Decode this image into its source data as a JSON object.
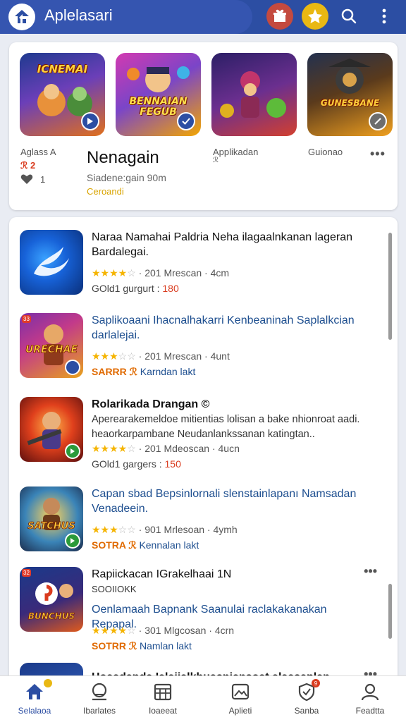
{
  "header": {
    "title": "Aplelasari",
    "icons": [
      "app-logo-icon",
      "gift-icon",
      "star-icon",
      "search-icon",
      "more-vert-icon"
    ]
  },
  "featured": {
    "tiles": [
      {
        "art_text": "ICNEMAI",
        "colors": [
          "#2a3f9a",
          "#e56a1c"
        ]
      },
      {
        "art_text": "BENNAIAN FEGUB",
        "colors": [
          "#c03ab8",
          "#f3c200"
        ]
      },
      {
        "art_text": "",
        "colors": [
          "#3b2b7a",
          "#d23a2f"
        ]
      },
      {
        "art_text": "GUNESBANE",
        "colors": [
          "#3b2a18",
          "#e89b22"
        ]
      }
    ],
    "caption_left": "Aglass A",
    "caption_left_code": "ℛ 2",
    "caption_left_count": "1",
    "title": "Nenagain",
    "subtitle": "Siadene:gain 90m",
    "tagline": "Ceroandi",
    "caption_3": "Applikadan",
    "caption_3_sub": "ℛ",
    "caption_4": "Guionao",
    "more": "•••"
  },
  "apps": [
    {
      "title": "Naraa Namahai Paldria Neha ilagaalnkanan lageran Bardalegai.",
      "title_style": "dark",
      "rating": 4,
      "meta": "· 201 Mrescan · 4cm",
      "extra_label": "GOld1 gurgurt : ",
      "extra_value": "180",
      "extra_style": "price"
    },
    {
      "title": "Saplikoaani Ihacnalhakarri Kenbeaninah Saplalkcian darlalejai.",
      "title_style": "blue",
      "rating": 3,
      "meta": "· 201 Mrescan · 4unt",
      "extra_label": "SARRR ℛ ",
      "extra_value": "Karndan lakt",
      "extra_style": "tag",
      "badge": "33"
    },
    {
      "title": "Rolarikada Drangan ©",
      "subtitle": "Aperearakemeldoe mitientias lolisan a bake nhionroat aadi. heaorkarpambane Neudanlankssanan katingtan..",
      "title_style": "mixed",
      "rating": 4,
      "meta": "· 201 Mdeoscan · 4ucn",
      "extra_label": "GOld1 gargers : ",
      "extra_value": "150",
      "extra_style": "price"
    },
    {
      "title": "Capan sbad Bepsinlornali slenstainlapanı Namsadan Venadeein.",
      "title_style": "blue",
      "rating": 3,
      "meta": "· 901 Mrlesoan · 4ymh",
      "extra_label": "SOTRA ℛ ",
      "extra_value": "Kennalan lakt",
      "extra_style": "tag"
    },
    {
      "title": "Rapiickacan IGrakelhaai 1N",
      "code": "SOOIIOKK",
      "subtitle": "Oenlamaah Bapnank Saanulai raclakakanakan Repapal.",
      "title_style": "mixed",
      "rating": 4,
      "meta": "· 301 Mlgcosan · 4crn",
      "extra_label": "SOTRR ℛ ",
      "extra_value": "Namlan lakt",
      "extra_style": "tag",
      "badge": "32",
      "more": "•••"
    },
    {
      "title": "Hoaadanda Ialaiialkhuasniansoat alaasaplan",
      "title_style": "dark",
      "more": "•••"
    }
  ],
  "bottom_nav": [
    {
      "label": "Selalaoa",
      "icon": "home-icon",
      "active": true
    },
    {
      "label": "Ibarlates",
      "icon": "store-icon"
    },
    {
      "label": "Ioaeeat",
      "icon": "grid-calendar-icon"
    },
    {
      "label": "Aplieti",
      "icon": "image-icon"
    },
    {
      "label": "Sanba",
      "icon": "shield-badge-icon",
      "badge": "9"
    },
    {
      "label": "Feadtta",
      "icon": "profile-icon"
    }
  ],
  "colors": {
    "header_bg": "#2c4ea3",
    "accent": "#2c4ea3",
    "star": "#f5b400",
    "price_red": "#d93b1e"
  }
}
